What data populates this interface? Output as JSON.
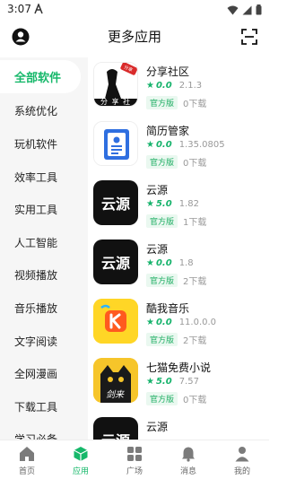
{
  "status": {
    "time": "3:07"
  },
  "header": {
    "title": "更多应用"
  },
  "sidebar": {
    "items": [
      {
        "label": "全部软件"
      },
      {
        "label": "系统优化"
      },
      {
        "label": "玩机软件"
      },
      {
        "label": "效率工具"
      },
      {
        "label": "实用工具"
      },
      {
        "label": "人工智能"
      },
      {
        "label": "视频播放"
      },
      {
        "label": "音乐播放"
      },
      {
        "label": "文字阅读"
      },
      {
        "label": "全网漫画"
      },
      {
        "label": "下载工具"
      },
      {
        "label": "学习必备"
      }
    ]
  },
  "apps": [
    {
      "name": "分享社区",
      "rating": "0.0",
      "version": "2.1.3",
      "badge": "官方版",
      "downloads": "0下载",
      "icon_text": "分 享 社",
      "icon_tag": "分享"
    },
    {
      "name": "简历管家",
      "rating": "0.0",
      "version": "1.35.0805",
      "badge": "官方版",
      "downloads": "0下载"
    },
    {
      "name": "云源",
      "rating": "5.0",
      "version": "1.82",
      "badge": "官方版",
      "downloads": "1下载",
      "icon_text": "云源"
    },
    {
      "name": "云源",
      "rating": "0.0",
      "version": "1.8",
      "badge": "官方版",
      "downloads": "2下载",
      "icon_text": "云源"
    },
    {
      "name": "酷我音乐",
      "rating": "0.0",
      "version": "11.0.0.0",
      "badge": "官方版",
      "downloads": "2下载"
    },
    {
      "name": "七猫免费小说",
      "rating": "5.0",
      "version": "7.57",
      "badge": "官方版",
      "downloads": "0下载",
      "icon_text": "剑来"
    },
    {
      "name": "云源",
      "rating": "",
      "version": "",
      "badge": "",
      "downloads": "",
      "icon_text": "云源"
    }
  ],
  "tabs": [
    {
      "label": "首页"
    },
    {
      "label": "应用"
    },
    {
      "label": "广场"
    },
    {
      "label": "消息"
    },
    {
      "label": "我的"
    }
  ],
  "colors": {
    "accent": "#16b86a",
    "star": "#17b36c"
  }
}
